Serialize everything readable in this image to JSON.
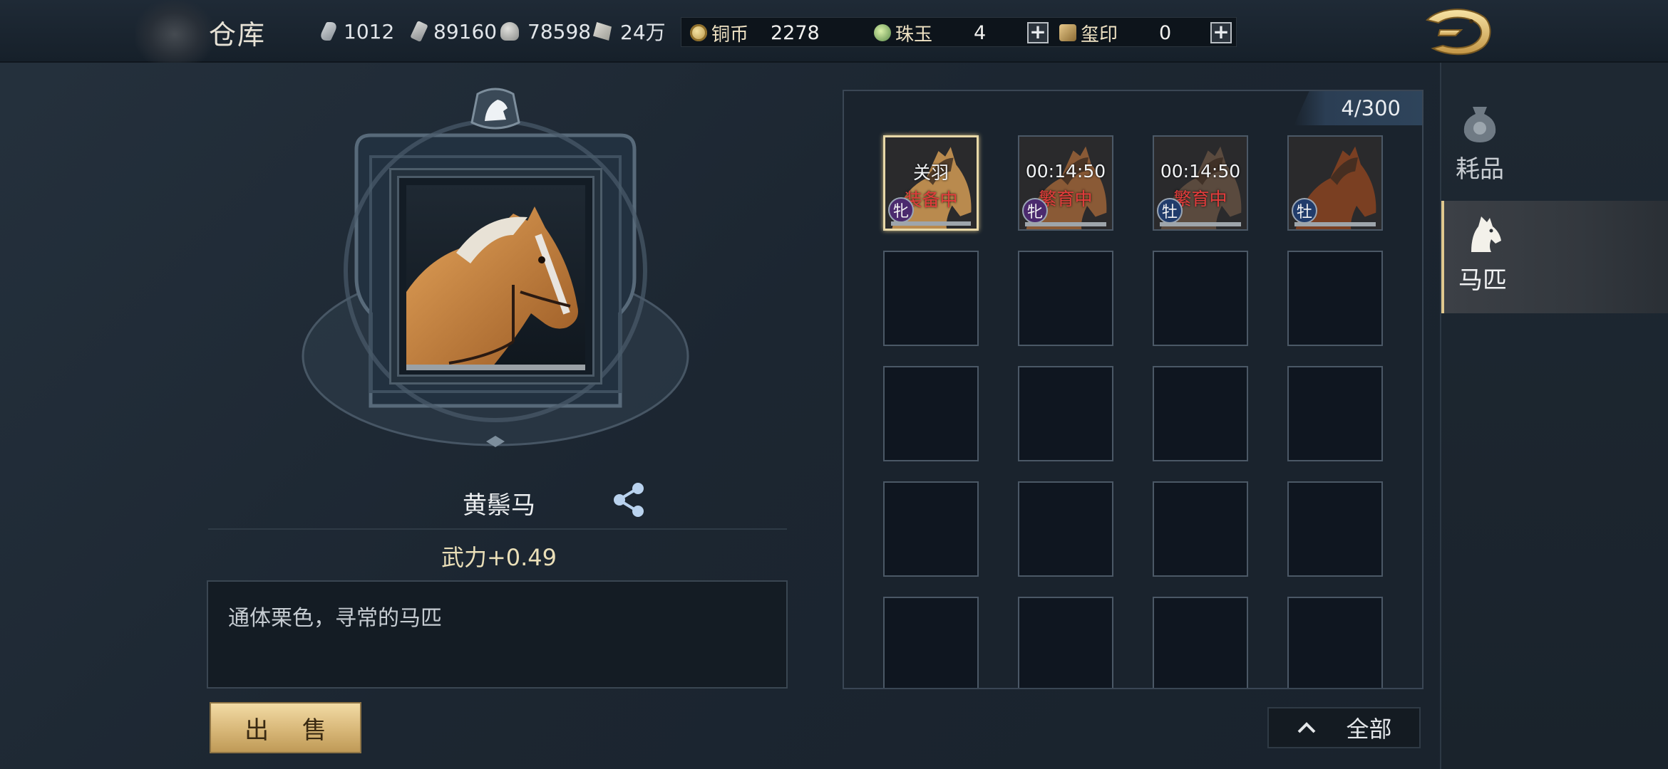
{
  "header": {
    "title": "仓库",
    "resources": [
      {
        "icon": "feather-icon",
        "value": "1012"
      },
      {
        "icon": "wood-icon",
        "value": "89160"
      },
      {
        "icon": "stone-icon",
        "value": "78598"
      },
      {
        "icon": "ore-icon",
        "value": "24万"
      }
    ],
    "currencies": [
      {
        "icon": "copper-coin-icon",
        "label": "铜币",
        "value": "2278"
      },
      {
        "icon": "jade-icon",
        "label": "珠玉",
        "value": "4"
      },
      {
        "icon": "seal-icon",
        "label": "玺印",
        "value": "0"
      }
    ],
    "plus_symbol": "+",
    "back_icon": "dragon-back-icon"
  },
  "detail": {
    "name": "黄鬃马",
    "stat": "武力+0.49",
    "description": "通体栗色，寻常的马匹",
    "sell_label": "出 售"
  },
  "inventory": {
    "capacity": "4/300",
    "items": [
      {
        "top_label": "关羽",
        "status": "装备中",
        "gender": "牝",
        "gender_type": "female",
        "selected": true,
        "coat": "#b98a4e"
      },
      {
        "timer": "00:14:50",
        "status": "繁育中",
        "gender": "牝",
        "gender_type": "female",
        "selected": false,
        "coat": "#8a5a36"
      },
      {
        "timer": "00:14:50",
        "status": "繁育中",
        "gender": "牡",
        "gender_type": "male",
        "selected": false,
        "coat": "#5a4a3e"
      },
      {
        "gender": "牡",
        "gender_type": "male",
        "selected": false,
        "coat": "#7a3f22"
      }
    ],
    "filter_label": "全部",
    "filter_icon": "chevron-up-icon"
  },
  "tabs": [
    {
      "label": "耗品",
      "icon": "pouch-icon",
      "active": false
    },
    {
      "label": "马匹",
      "icon": "horse-head-icon",
      "active": true
    }
  ],
  "colors": {
    "accent_gold": "#e0c88e",
    "status_red": "#e33c3c",
    "sell_button": "#d8b778"
  }
}
